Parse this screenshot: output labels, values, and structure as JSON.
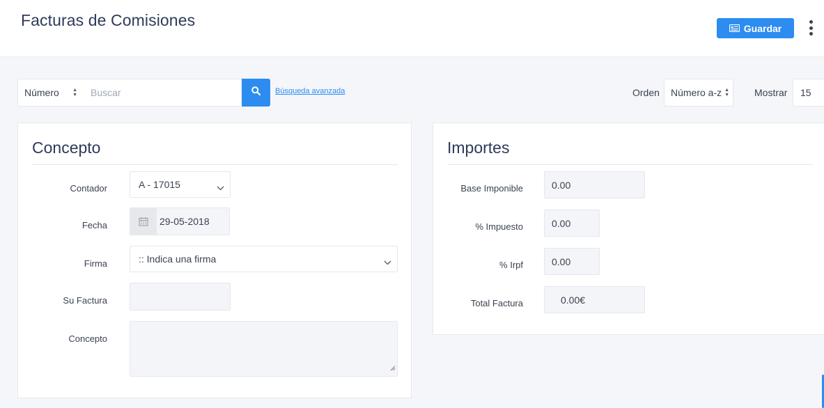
{
  "header": {
    "title": "Facturas de Comisiones",
    "save_label": "Guardar"
  },
  "search": {
    "field_value": "Número",
    "placeholder": "Buscar",
    "advanced_link": "Búsqueda avanzada",
    "orden_label": "Orden",
    "orden_value": "Número a-z",
    "mostrar_label": "Mostrar",
    "mostrar_value": "15"
  },
  "concepto": {
    "title": "Concepto",
    "contador_label": "Contador",
    "contador_value": "A - 17015",
    "fecha_label": "Fecha",
    "fecha_value": "29-05-2018",
    "firma_label": "Firma",
    "firma_value": ":: Indica una firma",
    "su_factura_label": "Su Factura",
    "su_factura_value": "",
    "concepto_label": "Concepto",
    "concepto_value": ""
  },
  "importes": {
    "title": "Importes",
    "base_label": "Base Imponible",
    "base_value": "0.00",
    "impuesto_label": "% Impuesto",
    "impuesto_value": "0.00",
    "irpf_label": "% Irpf",
    "irpf_value": "0.00",
    "total_label": "Total Factura",
    "total_value": "0.00€"
  },
  "colors": {
    "accent": "#2d8cf0",
    "title": "#2e3a59",
    "background": "#f4f6f9"
  },
  "icons": [
    "save-icon",
    "kebab-menu-icon",
    "search-icon",
    "calendar-icon",
    "chevron-down-icon",
    "sort-arrows-icon",
    "resize-handle-icon"
  ]
}
